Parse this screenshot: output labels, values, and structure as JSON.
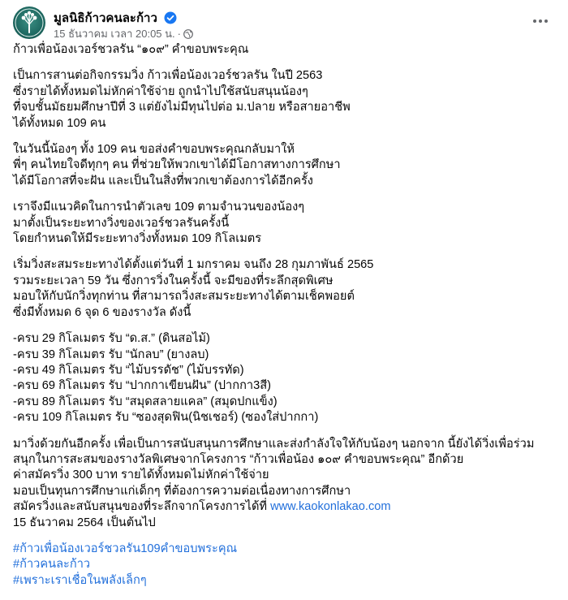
{
  "page": {
    "name": "มูลนิธิก้าวคนละก้าว",
    "date": "15 ธันวาคม เวลา 20:05 น.",
    "dot": "·"
  },
  "post": {
    "title": "ก้าวเพื่อน้องเวอร์ชวลรัน “๑๐๙” คำขอบพระคุณ",
    "p1": [
      "เป็นการสานต่อกิจกรรมวิ่ง ก้าวเพื่อน้องเวอร์ชวลรัน ในปี 2563",
      "ซึ่งรายได้ทั้งหมดไม่หักค่าใช้จ่าย ถูกนำไปใช้สนับสนุนน้องๆ",
      "ที่จบชั้นมัธยมศึกษาปีที่ 3 แต่ยังไม่มีทุนไปต่อ ม.ปลาย หรือสายอาชีพ",
      "ได้ทั้งหมด 109 คน"
    ],
    "p2": [
      "ในวันนี้น้องๆ ทั้ง 109 คน ขอส่งคำขอบพระคุณกลับมาให้",
      "พี่ๆ คนไทยใจดีทุกๆ คน ที่ช่วยให้พวกเขาได้มีโอกาสทางการศึกษา",
      "ได้มีโอกาสที่จะฝัน และเป็นในสิ่งที่พวกเขาต้องการได้อีกครั้ง"
    ],
    "p3": [
      "เราจึงมีแนวคิดในการนำตัวเลข 109 ตามจำนวนของน้องๆ",
      "มาตั้งเป็นระยะทางวิ่งของเวอร์ชวลรันครั้งนี้",
      "โดยกำหนดให้มีระยะทางวิ่งทั้งหมด 109 กิโลเมตร"
    ],
    "p4": [
      "เริ่มวิ่งสะสมระยะทางได้ตั้งแต่วันที่ 1 มกราคม จนถึง 28 กุมภาพันธ์ 2565",
      "รวมระยะเวลา 59 วัน ซึ่งการวิ่งในครั้งนี้ จะมีของที่ระลึกสุดพิเศษ",
      "มอบให้กับนักวิ่งทุกท่าน ที่สามารถวิ่งสะสมระยะทางได้ตามเช็คพอยต์",
      "ซึ่งมีทั้งหมด 6 จุด 6 ของรางวัล ดังนี้"
    ],
    "rewards": [
      "-ครบ 29 กิโลเมตร รับ “ด.ส.” (ดินสอไม้)",
      "-ครบ 39 กิโลเมตร รับ “นักลบ” (ยางลบ)",
      "-ครบ 49 กิโลเมตร รับ “ไม้บรรดัช” (ไม้บรรทัด)",
      "-ครบ 69 กิโลเมตร รับ “ปากกาเขียนฝัน” (ปากกา3สี)",
      "-ครบ 89 กิโลเมตร รับ “สมุดสลายแคล” (สมุดปกแข็ง)",
      "-ครบ 109 กิโลเมตร รับ “ซองสุดฟิน(นิชเชอร์) (ซองใส่ปากกา)"
    ],
    "p6": [
      "มาวิ่งด้วยกันอีกครั้ง เพื่อเป็นการสนับสนุนการศึกษาและส่งกำลังใจให้กับน้องๆ นอกจาก นี้ยังได้วิ่งเพื่อร่วม",
      "สนุกในการสะสมของรางวัลพิเศษจากโครงการ “ก้าวเพื่อน้อง ๑๐๙ คำขอบพระคุณ” อีกด้วย",
      "ค่าสมัครวิ่ง 300 บาท รายได้ทั้งหมดไม่หักค่าใช้จ่าย",
      "มอบเป็นทุนการศึกษาแก่เด็กๆ ที่ต้องการความต่อเนื่องทางการศึกษา"
    ],
    "p6_link_prefix": "สมัครวิ่งและสนับสนุนของที่ระลึกจากโครงการได้ที่ ",
    "p6_link": "www.kaokonlakao.com",
    "p6_last": "15 ธันวาคม 2564 เป็นต้นไป",
    "hashtags": [
      "#ก้าวเพื่อน้องเวอร์ชวลรัน109คำขอบพระคุณ",
      "#ก้าวคนละก้าว",
      "#เพราะเราเชื่อในพลังเล็กๆ"
    ]
  },
  "colors": {
    "link": "#216fdb",
    "verified": "#1877f2",
    "meta": "#65676b",
    "avatar": "#1f6a62"
  },
  "icons": {
    "verified": "verified-badge-icon",
    "privacy": "globe-icon",
    "more": "more-options-icon"
  }
}
